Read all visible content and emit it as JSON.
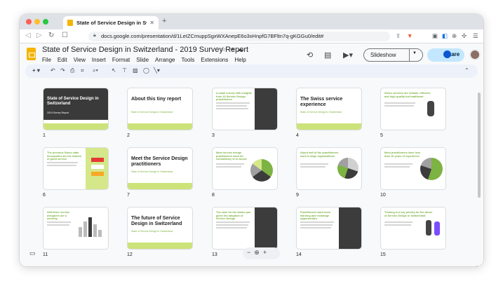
{
  "browser": {
    "tab_title": "State of Service Design in Switz",
    "url": "docs.google.com/presentation/d/1LeIZCmuppSgxWXAnepE6o3xHnpfG7BFltn7q-gKGGu0/edit#",
    "colors": {
      "close": "#ff5f57",
      "minimize": "#febc2e",
      "maximize": "#28c840"
    }
  },
  "doc": {
    "title": "State of Service Design in Switzerland - 2019 Survey Report",
    "menus": [
      "File",
      "Edit",
      "View",
      "Insert",
      "Format",
      "Slide",
      "Arrange",
      "Tools",
      "Extensions",
      "Help"
    ],
    "slideshow_label": "Slideshow",
    "share_label": "Share"
  },
  "slides": [
    {
      "num": "1",
      "title": "State of Service Design in Switzerland",
      "subtitle": "2019 Survey Report",
      "variant": "cover"
    },
    {
      "num": "2",
      "title": "About this tiny report",
      "subtitle": "State of Service Design in Switzerland",
      "variant": "section"
    },
    {
      "num": "3",
      "title": "A small survey with insights from 32 Service Design practitioners",
      "variant": "text-dark"
    },
    {
      "num": "4",
      "title": "The Swiss service experience",
      "subtitle": "State of Service Design in Switzerland",
      "variant": "section"
    },
    {
      "num": "5",
      "title": "Swiss services are reliable, efficient, and high quality but traditional",
      "variant": "text-figure"
    },
    {
      "num": "6",
      "title": "The precious Swiss state monopolies are the leaders of good service",
      "variant": "text-logos"
    },
    {
      "num": "7",
      "title": "Meet the Service Design practitioners",
      "subtitle": "State of Service Design in Switzerland",
      "variant": "section"
    },
    {
      "num": "8",
      "title": "Most service design practitioners work for consultancy or in-house",
      "variant": "text-pie"
    },
    {
      "num": "9",
      "title": "About half of the practitioners work in large organizations",
      "variant": "text-pie"
    },
    {
      "num": "10",
      "title": "Most practitioners have less than 10 years of experience",
      "variant": "text-pie"
    },
    {
      "num": "11",
      "title": "Still fewer service designers are a minority",
      "variant": "text-bars"
    },
    {
      "num": "12",
      "title": "The future of Service Design in Switzerland",
      "subtitle": "State of Service Design in Switzerland",
      "variant": "section"
    },
    {
      "num": "13",
      "title": "The case for the status quo given the adoption of Service Design",
      "variant": "text-dark"
    },
    {
      "num": "14",
      "title": "Practitioners want more learning and exchange opportunities",
      "variant": "text-dark"
    },
    {
      "num": "15",
      "title": "Training is a key priority for the future of Service Design in Switzerland",
      "variant": "text-figure"
    }
  ]
}
